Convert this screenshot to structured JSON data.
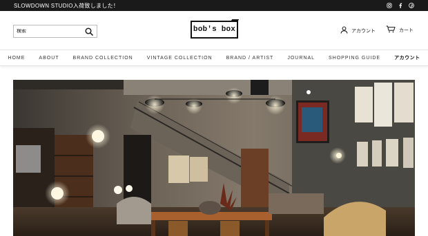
{
  "announcement": "SLOWDOWN STUDIO入荷致しました！",
  "social_icons": [
    "instagram-icon",
    "facebook-icon",
    "pinterest-icon"
  ],
  "search": {
    "placeholder": "検索"
  },
  "logo": {
    "text": "bob's box"
  },
  "header": {
    "account_label": "アカウント",
    "cart_label": "カート"
  },
  "nav": {
    "items": [
      "HOME",
      "ABOUT",
      "BRAND COLLECTION",
      "VINTAGE COLLECTION",
      "BRAND / ARTIST",
      "JOURNAL",
      "SHOPPING GUIDE",
      "アカウント"
    ]
  },
  "colors": {
    "topbar": "#1a1a1a",
    "text": "#222222",
    "border": "#bbbbbb"
  }
}
